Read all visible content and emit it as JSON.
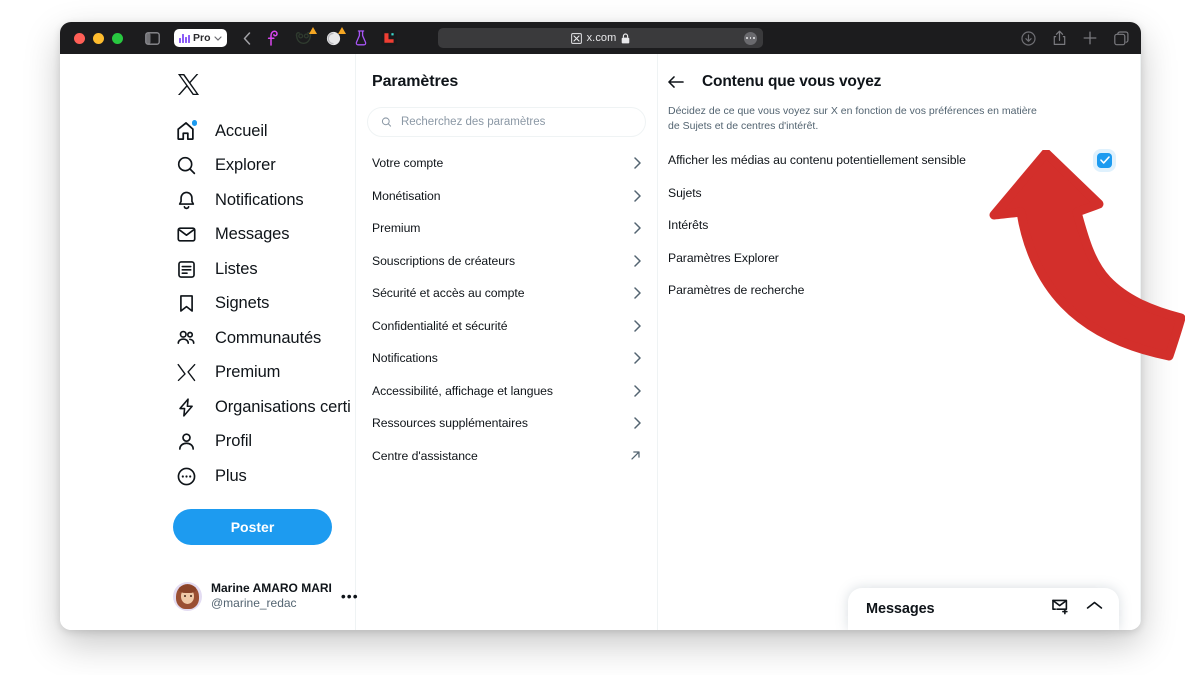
{
  "browser": {
    "traffic_lights": [
      "close",
      "minimize",
      "maximize"
    ],
    "sidebar_toggle_icon": "sidebar-toggle-icon",
    "pro_pill_label": "Pro",
    "back_icon": "chevron-left-icon",
    "extensions": [
      {
        "name": "honey-extension-icon",
        "badge": false
      },
      {
        "name": "owl-extension-icon",
        "badge": true
      },
      {
        "name": "ghostery-extension-icon",
        "badge": true
      },
      {
        "name": "flask-extension-icon",
        "badge": false
      },
      {
        "name": "red-app-extension-icon",
        "badge": false
      }
    ],
    "url": "x.com",
    "url_favicon": "x-logo-icon",
    "url_lock_icon": "lock-icon",
    "url_menu_icon": "ellipsis-icon",
    "right_icons": [
      "downloads-icon",
      "share-icon",
      "new-tab-icon",
      "tab-overview-icon"
    ]
  },
  "sidebar": {
    "logo": "x-logo-icon",
    "items": [
      {
        "label": "Accueil",
        "icon": "home-icon",
        "badge": true
      },
      {
        "label": "Explorer",
        "icon": "search-icon",
        "badge": false
      },
      {
        "label": "Notifications",
        "icon": "bell-icon",
        "badge": false
      },
      {
        "label": "Messages",
        "icon": "envelope-icon",
        "badge": false
      },
      {
        "label": "Listes",
        "icon": "list-icon",
        "badge": false
      },
      {
        "label": "Signets",
        "icon": "bookmark-icon",
        "badge": false
      },
      {
        "label": "Communautés",
        "icon": "communities-icon",
        "badge": false
      },
      {
        "label": "Premium",
        "icon": "x-logo-icon",
        "badge": false
      },
      {
        "label": "Organisations certi",
        "icon": "verified-org-icon",
        "badge": false
      },
      {
        "label": "Profil",
        "icon": "person-icon",
        "badge": false
      },
      {
        "label": "Plus",
        "icon": "more-circle-icon",
        "badge": false
      }
    ],
    "post_button_label": "Poster",
    "account": {
      "name": "Marine AMARO MARI",
      "handle": "@marine_redac",
      "avatar": "avatar",
      "more_icon": "ellipsis-icon"
    }
  },
  "settings": {
    "title": "Paramètres",
    "search_placeholder": "Recherchez des paramètres",
    "search_value": "",
    "search_icon": "search-icon",
    "items": [
      {
        "label": "Votre compte",
        "chevron": "chevron-right-icon"
      },
      {
        "label": "Monétisation",
        "chevron": "chevron-right-icon"
      },
      {
        "label": "Premium",
        "chevron": "chevron-right-icon"
      },
      {
        "label": "Souscriptions de créateurs",
        "chevron": "chevron-right-icon"
      },
      {
        "label": "Sécurité et accès au compte",
        "chevron": "chevron-right-icon"
      },
      {
        "label": "Confidentialité et sécurité",
        "chevron": "chevron-right-icon"
      },
      {
        "label": "Notifications",
        "chevron": "chevron-right-icon"
      },
      {
        "label": "Accessibilité, affichage et langues",
        "chevron": "chevron-right-icon"
      },
      {
        "label": "Ressources supplémentaires",
        "chevron": "chevron-right-icon"
      },
      {
        "label": "Centre d'assistance",
        "chevron": "external-link-icon"
      }
    ]
  },
  "detail": {
    "back_icon": "arrow-left-icon",
    "title": "Contenu que vous voyez",
    "description": "Décidez de ce que vous voyez sur X en fonction de vos préférences en matière de Sujets et de centres d'intérêt.",
    "sensitive_media": {
      "label": "Afficher les médias au contenu potentiellement sensible",
      "checked": true,
      "check_icon": "check-icon"
    },
    "items": [
      {
        "label": "Sujets"
      },
      {
        "label": "Intérêts"
      },
      {
        "label": "Paramètres Explorer"
      },
      {
        "label": "Paramètres de recherche"
      }
    ]
  },
  "messages_dock": {
    "title": "Messages",
    "new_message_icon": "new-message-icon",
    "expand_icon": "chevron-up-icon"
  },
  "annotation": {
    "arrow": "red-curved-arrow-up",
    "color": "#D32F2B"
  },
  "colors": {
    "accent": "#1D9BF0",
    "text": "#0F1419",
    "muted": "#536471",
    "border": "#EFF3F4",
    "toolbar_bg": "#1C1C1E",
    "annotation_red": "#D32F2B"
  }
}
